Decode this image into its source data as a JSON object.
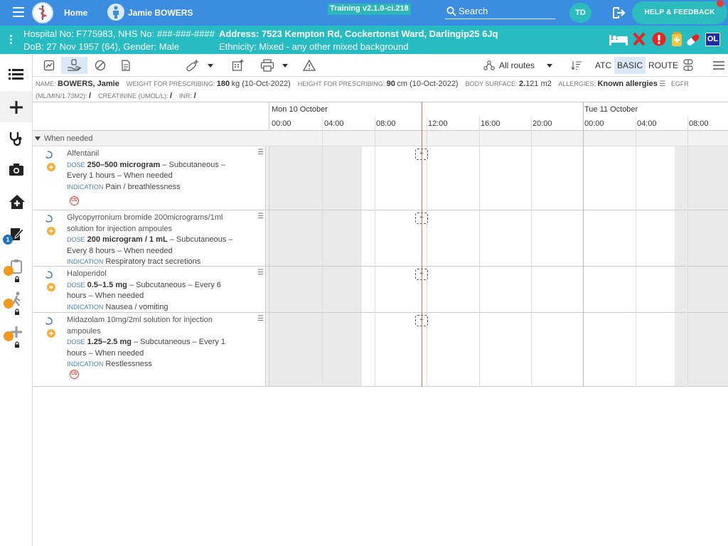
{
  "topbar": {
    "home": "Home",
    "patient_name": "Jamie BOWERS",
    "env": "Training v2.1.0-ci.218",
    "search_label": "Search",
    "user_initials": "TD",
    "help": "HELP & FEEDBACK"
  },
  "banner": {
    "hospital_no": "Hospital No: F775983, NHS No: ###-###-####",
    "address": "Address: 7523 Kempton Rd, Cockertonst Ward, Darlingip25 6Jq",
    "dob": "DoB: 27 Nov 1957 (64), Gender: Male",
    "ethnicity": "Ethnicity: Mixed - any other mixed background",
    "ol_badge": "OL"
  },
  "rail": {
    "tasks_badge": "1"
  },
  "toolbar": {
    "routes": "All routes",
    "atc": "ATC",
    "basic": "BASIC",
    "route": "ROUTE"
  },
  "demographics": {
    "name_label": "NAME:",
    "name": "BOWERS, Jamie",
    "weight_label": "WEIGHT FOR PRESCRIBING:",
    "weight_value": "180",
    "weight_unit": "kg (10-Oct-2022)",
    "height_label": "HEIGHT FOR PRESCRIBING:",
    "height_value": "90",
    "height_unit": "cm (10-Oct-2022)",
    "bsa_label": "BODY SURFACE:",
    "bsa_value": "2.",
    "bsa_unit": "121 m2",
    "allergies_label": "ALLERGIES:",
    "allergies": "Known allergies",
    "egfr_label": "EGFR",
    "egfr_unit": "(ML/MIN/1.73M2):",
    "egfr_value": "/",
    "creat_label": "CREATININE (UMOL/L):",
    "creat_value": "/",
    "inr_label": "INR:",
    "inr_value": "/"
  },
  "chart": {
    "day1": "Mon 10 October",
    "day2": "Tue 11 October",
    "hours": [
      "00:00",
      "04:00",
      "08:00",
      "12:00",
      "16:00",
      "20:00",
      "00:00",
      "04:00",
      "08:00"
    ],
    "section": "When needed",
    "add_symbol": "+"
  },
  "meds": [
    {
      "name": "Alfentanil",
      "dose_label": "DOSE",
      "dose": "250–500 microgram",
      "route_freq_a": " – Subcutaneous –",
      "route_freq_b": "Every 1 hours – When needed",
      "indication_label": "INDICATION",
      "indication": "Pain / breathlessness",
      "cd": "CD"
    },
    {
      "name_a": "Glycopyrronium bromide 200micrograms/1ml",
      "name_b": "solution for injection ampoules",
      "dose_label": "DOSE",
      "dose": "200 microgram / 1 mL",
      "route_freq_a": " – Subcutaneous –",
      "route_freq_b": "Every 8 hours – When needed",
      "indication_label": "INDICATION",
      "indication": "Respiratory tract secretions"
    },
    {
      "name": "Haloperidol",
      "dose_label": "DOSE",
      "dose": "0.5–1.5 mg",
      "route_freq_a": " – Subcutaneous – Every 6",
      "route_freq_b": "hours – When needed",
      "indication_label": "INDICATION",
      "indication": "Nausea / vomiting"
    },
    {
      "name_a": "Midazolam 10mg/2ml solution for injection",
      "name_b": "ampoules",
      "dose_label": "DOSE",
      "dose": "1.25–2.5 mg",
      "route_freq_a": " – Subcutaneous – Every 1",
      "route_freq_b": "hours – When needed",
      "indication_label": "INDICATION",
      "indication": "Restlessness",
      "cd": "CD"
    }
  ],
  "colors": {
    "topbar": "#3b8de2",
    "banner": "#27bcc2",
    "accent": "#2bbdbd",
    "now_line": "#e06d5a"
  }
}
